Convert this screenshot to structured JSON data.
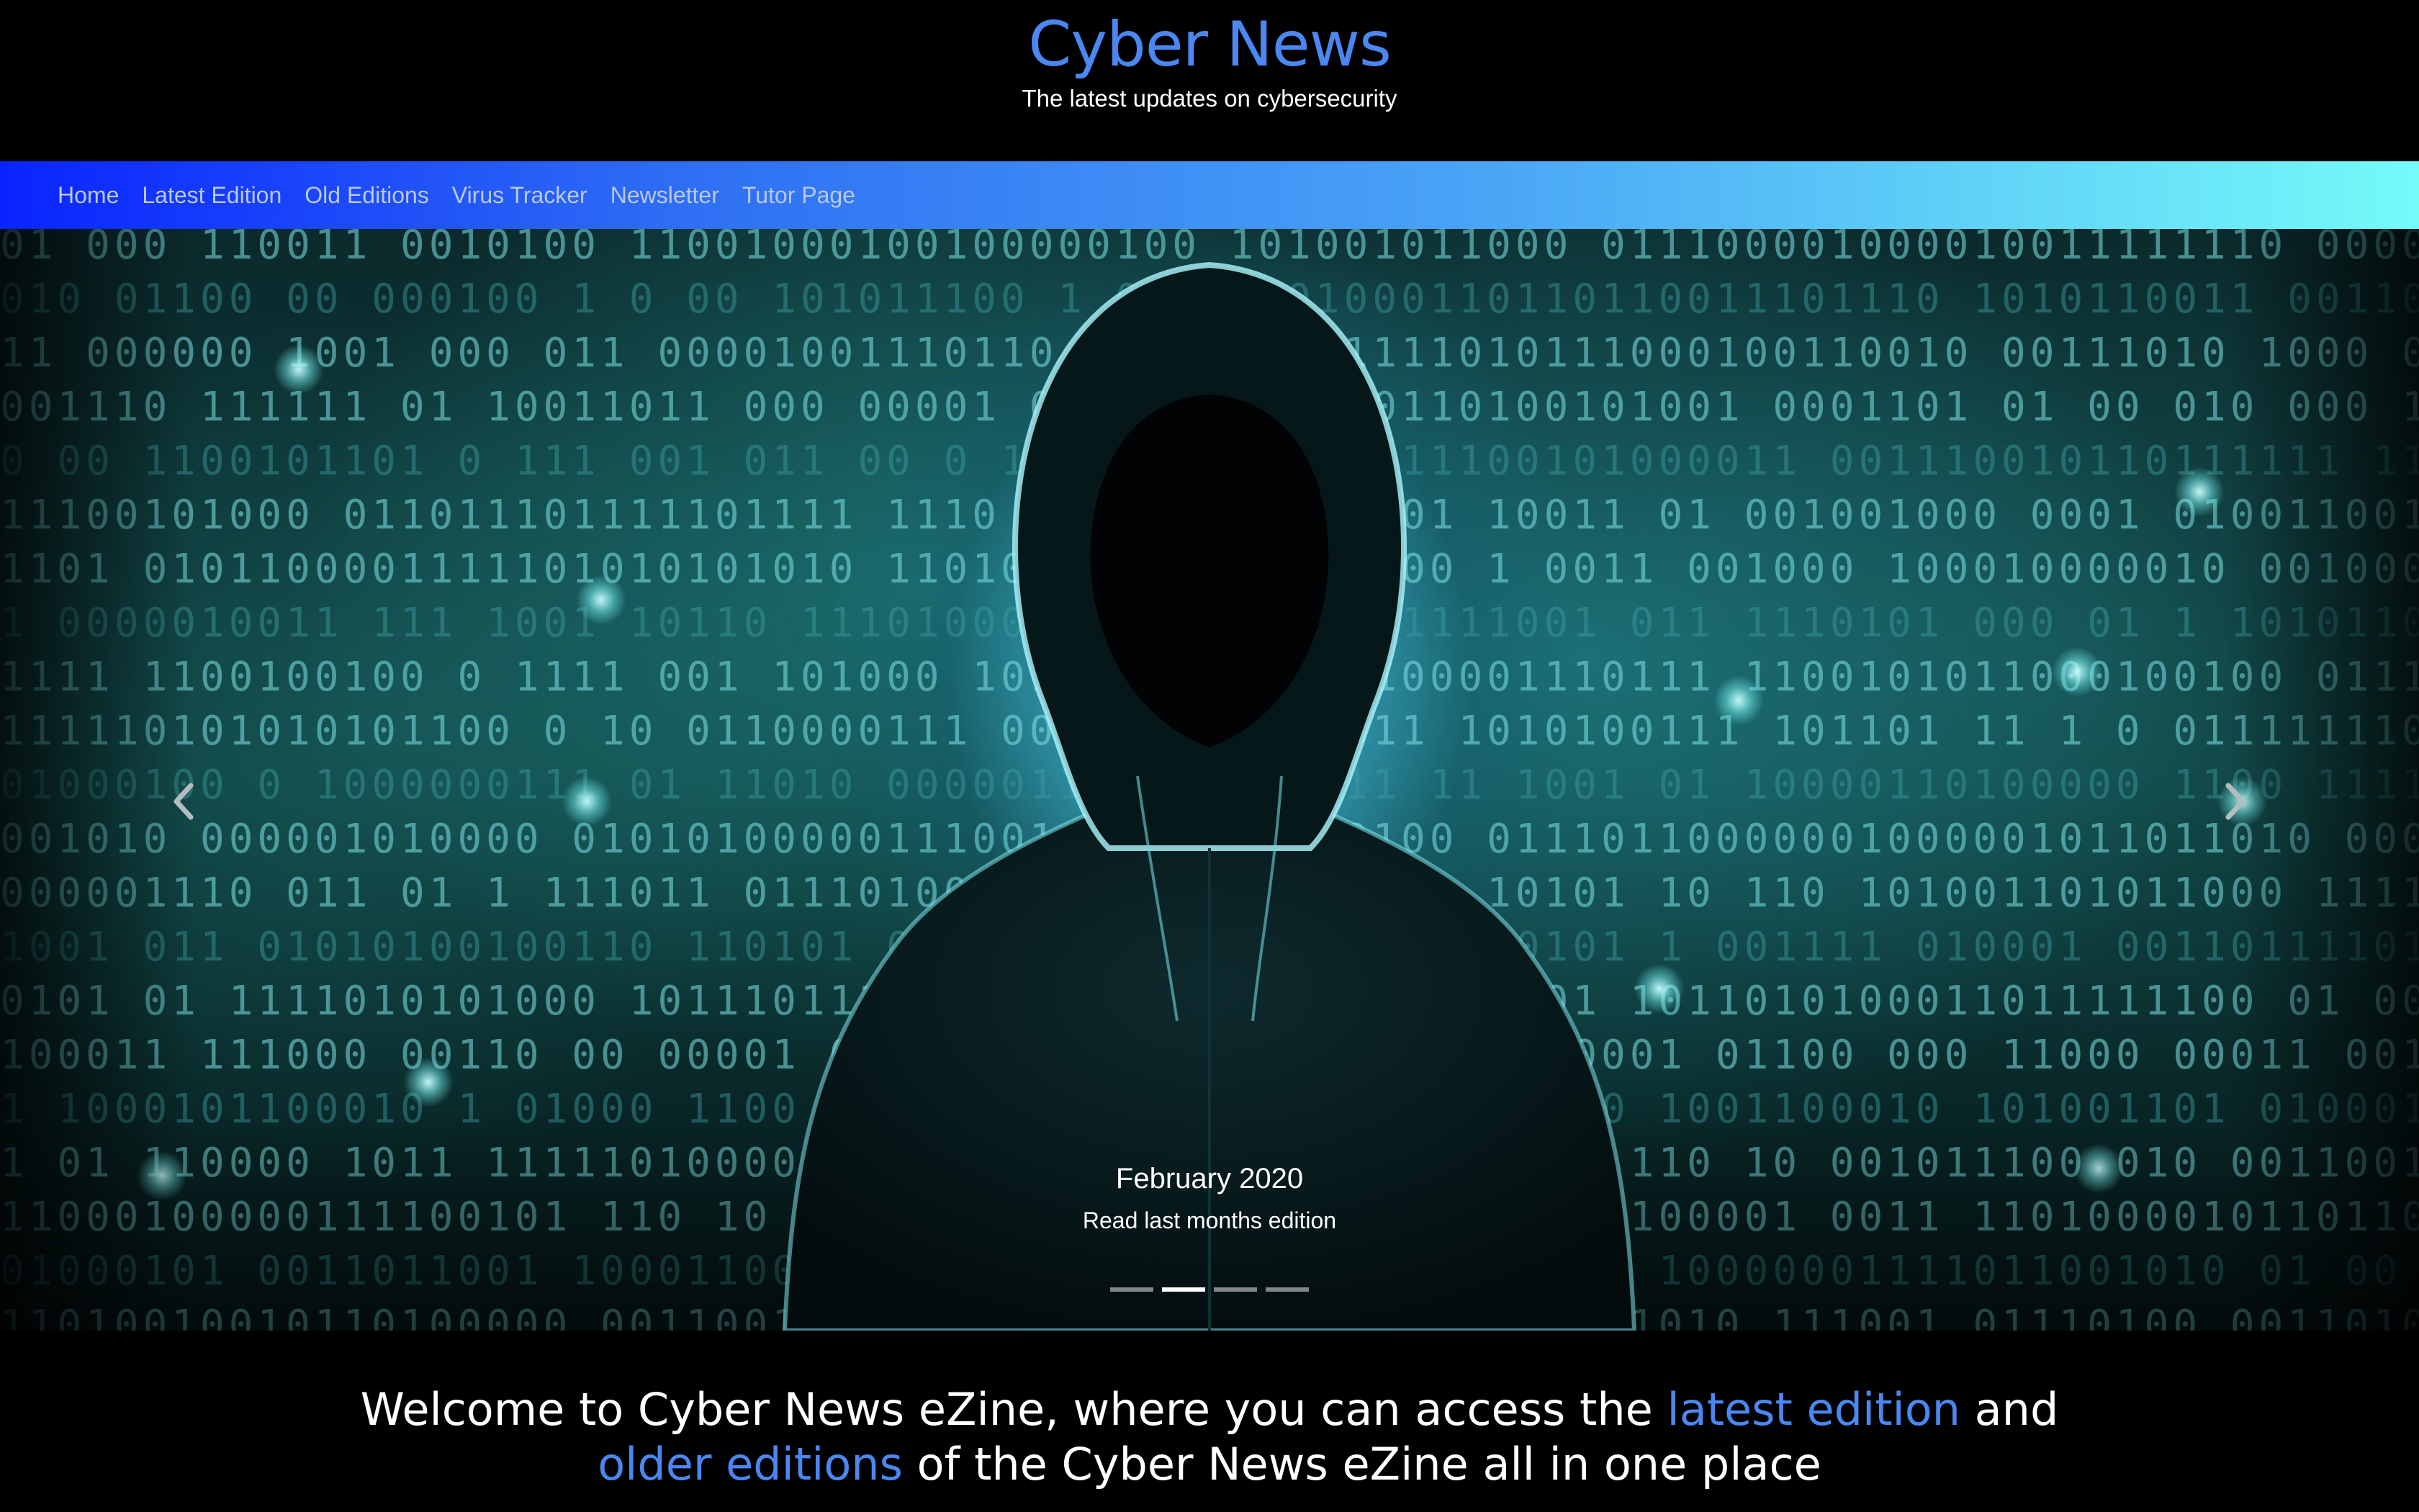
{
  "header": {
    "title": "Cyber News",
    "tagline": "The latest updates on cybersecurity"
  },
  "nav": {
    "items": [
      {
        "label": "Home"
      },
      {
        "label": "Latest Edition"
      },
      {
        "label": "Old Editions"
      },
      {
        "label": "Virus Tracker"
      },
      {
        "label": "Newsletter"
      },
      {
        "label": "Tutor Page"
      }
    ]
  },
  "carousel": {
    "caption_title": "February 2020",
    "caption_text": "Read last months edition",
    "slide_count": 4,
    "active_slide": 2,
    "prev_icon": "chevron-left-icon",
    "next_icon": "chevron-right-icon"
  },
  "welcome": {
    "part1": "Welcome to Cyber News eZine, where you can access the ",
    "link1": "latest edition",
    "part2": " and",
    "link2": "older editions",
    "part3": " of the Cyber News eZine all in one place"
  },
  "colors": {
    "brand_blue": "#4b87f2",
    "nav_gradient_start": "#0a24ff",
    "nav_gradient_end": "#74fbf8",
    "background": "#000000"
  }
}
